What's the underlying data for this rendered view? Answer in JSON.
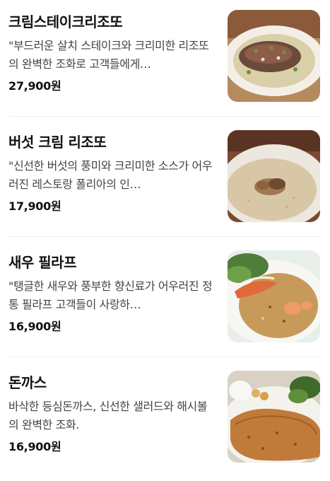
{
  "menu": {
    "items": [
      {
        "name": "크림스테이크리조또",
        "description": "\"부드러운 살치 스테이크와 크리미한 리조또의 완벽한 조화로 고객들에게…",
        "price": "27,900원",
        "image": "steak-risotto-photo"
      },
      {
        "name": "버섯 크림 리조또",
        "description": "\"신선한 버섯의 풍미와 크리미한 소스가 어우러진 레스토랑 폴리아의 인…",
        "price": "17,900원",
        "image": "mushroom-risotto-photo"
      },
      {
        "name": "새우 필라프",
        "description": "\"탱글한 새우와 풍부한 향신료가 어우러진 정통 필라프 고객들이 사랑하…",
        "price": "16,900원",
        "image": "shrimp-pilaf-photo"
      },
      {
        "name": "돈까스",
        "description": "바삭한 등심돈까스, 신선한 샐러드와 해시볼의 완벽한 조화.",
        "price": "16,900원",
        "image": "pork-cutlet-photo"
      }
    ]
  }
}
